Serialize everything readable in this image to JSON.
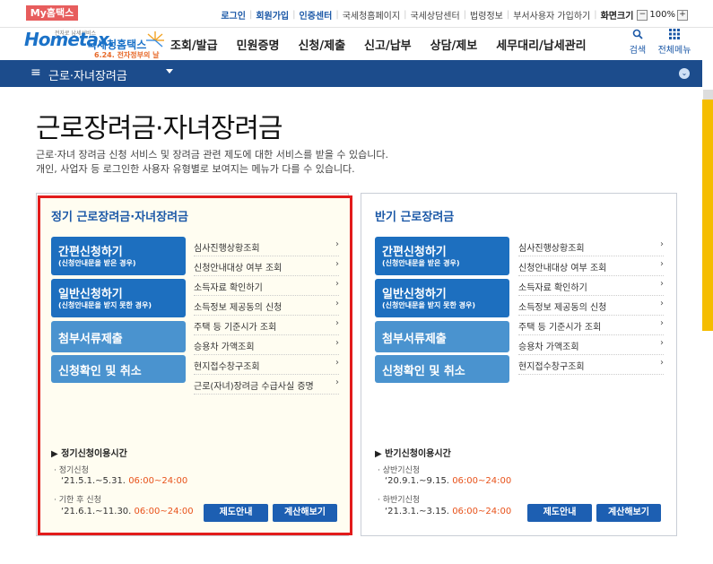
{
  "topbar": {
    "my_tab": "My홈택스",
    "links": [
      "로그인",
      "회원가입",
      "인증센터",
      "국세청홈페이지",
      "국세상담센터",
      "법령정보",
      "부서사용자 가입하기",
      "화면크기"
    ],
    "zoom": "100%",
    "zoom_minus": "−",
    "zoom_plus": "+"
  },
  "logo": {
    "home": "Hometax.",
    "name": "국세청홈택스",
    "date": "6.24. 전자정부의 날",
    "small": "전자로 납세서비스"
  },
  "gnb": [
    "조회/발급",
    "민원증명",
    "신청/제출",
    "신고/납부",
    "상담/제보",
    "세무대리/납세관리"
  ],
  "header_right": {
    "search": "검색",
    "menu": "전체메뉴"
  },
  "navbar": {
    "title": "근로·자녀장려금",
    "menu_icon": "≡"
  },
  "page": {
    "title": "근로장려금·자녀장려금",
    "desc1": "근로·자녀 장려금 신청 서비스 및 장려금 관련 제도에 대한 서비스를 받을 수 있습니다.",
    "desc2": "개인, 사업자 등 로그인한 사용자 유형별로 보여지는 메뉴가 다를 수 있습니다."
  },
  "left_panel": {
    "title": "정기 근로장려금·자녀장려금",
    "buttons": [
      {
        "label": "간편신청하기",
        "sub": "(신청안내문을 받은 경우)"
      },
      {
        "label": "일반신청하기",
        "sub": "(신청안내문을 받지 못한 경우)"
      },
      {
        "label": "첨부서류제출",
        "sub": ""
      },
      {
        "label": "신청확인 및 취소",
        "sub": ""
      }
    ],
    "links": [
      "심사진행상황조회",
      "신청안내대상 여부 조회",
      "소득자료 확인하기",
      "소득정보 제공동의 신청",
      "주택 등 기준시가 조회",
      "승용차 가액조회",
      "현지접수창구조회",
      "근로(자녀)장려금 수급사실 증명"
    ],
    "hours_title": "정기신청이용시간",
    "hours": [
      {
        "k": "정기신청",
        "date": "‘21.5.1.~5.31.",
        "time": "06:00~24:00"
      },
      {
        "k": "기한 후 신청",
        "date": "‘21.6.1.~11.30.",
        "time": "06:00~24:00"
      }
    ],
    "btn_guide": "제도안내",
    "btn_calc": "계산해보기"
  },
  "right_panel": {
    "title": "반기 근로장려금",
    "buttons": [
      {
        "label": "간편신청하기",
        "sub": "(신청안내문을 받은 경우)"
      },
      {
        "label": "일반신청하기",
        "sub": "(신청안내문을 받지 못한 경우)"
      },
      {
        "label": "첨부서류제출",
        "sub": ""
      },
      {
        "label": "신청확인 및 취소",
        "sub": ""
      }
    ],
    "links": [
      "심사진행상황조회",
      "신청안내대상 여부 조회",
      "소득자료 확인하기",
      "소득정보 제공동의 신청",
      "주택 등 기준시가 조회",
      "승용차 가액조회",
      "현지접수창구조회"
    ],
    "hours_title": "반기신청이용시간",
    "hours": [
      {
        "k": "상반기신청",
        "date": "‘20.9.1.~9.15.",
        "time": "06:00~24:00"
      },
      {
        "k": "하반기신청",
        "date": "‘21.3.1.~3.15.",
        "time": "06:00~24:00"
      }
    ],
    "btn_guide": "제도안내",
    "btn_calc": "계산해보기"
  },
  "colors": {
    "brand": "#1c4c8c",
    "button_dark": "#1d6fbf",
    "button_light": "#4a93cf",
    "highlight": "#e21b1b",
    "time": "#e8521a"
  }
}
